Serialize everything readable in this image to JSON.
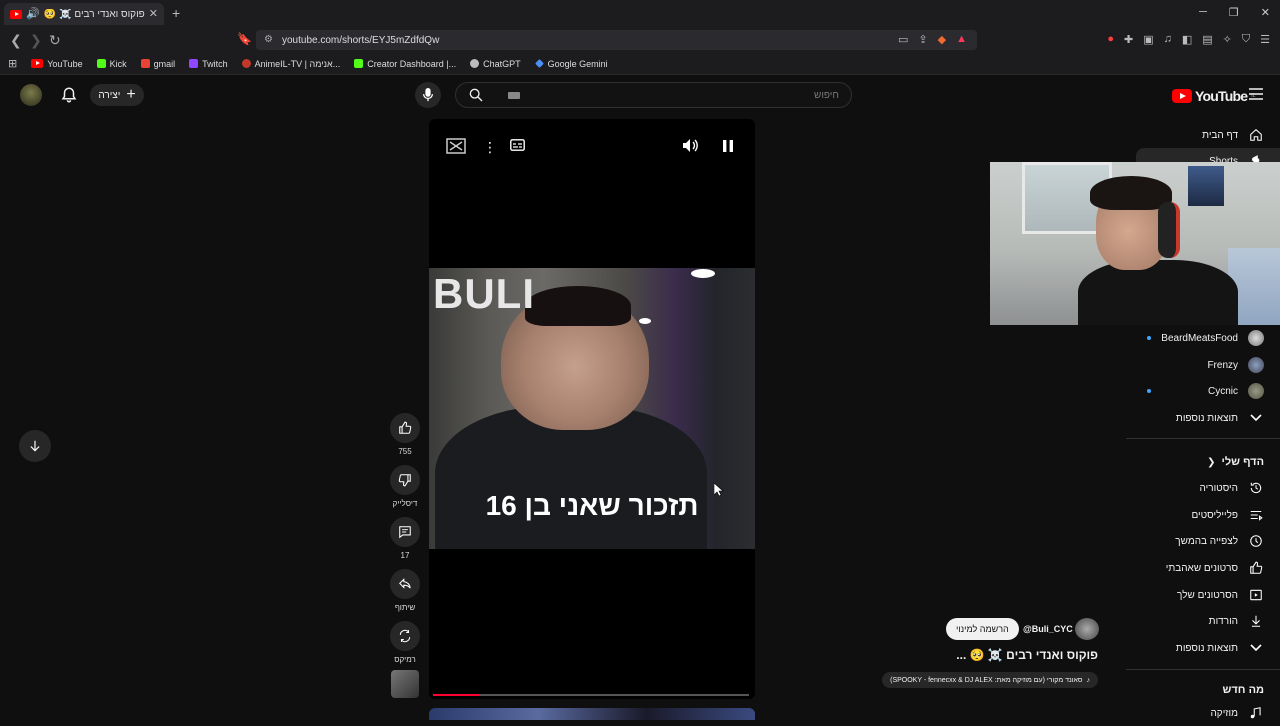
{
  "browser": {
    "tab_title": "פוקוס ואנדי רבים ☠️ 🥺 #fyp",
    "url": "youtube.com/shorts/EYJ5mZdfdQw",
    "bookmarks": [
      "YouTube",
      "Kick",
      "gmail",
      "Twitch",
      "AnimeIL-TV | אנימה...",
      "Creator Dashboard |...",
      "ChatGPT",
      "Google Gemini"
    ]
  },
  "header": {
    "create_label": "יצירה",
    "search_placeholder": "חיפוש",
    "logo_text": "YouTube",
    "logo_region": "IL"
  },
  "player": {
    "overlay_text": "BULI",
    "caption": "תזכור שאני בן 16",
    "progress": 0.15
  },
  "actions": {
    "like_count": "755",
    "dislike_label": "דיסלייק",
    "comment_count": "17",
    "share_label": "שיתוף",
    "remix_label": "רמיקס"
  },
  "video_info": {
    "channel": "@Buli_CYC",
    "subscribe_label": "הרשמה למינוי",
    "title": "פוקוס ואנדי רבים ☠️ 🥺 ...",
    "music": "סאונד מקורי (עם מוזיקה מאת: SPOOKY - fennecxx & DJ ALEX)"
  },
  "sidebar": {
    "home": "דף הבית",
    "shorts": "Shorts",
    "subscriptions": [
      {
        "name": "BeardMeatsFood",
        "new": true
      },
      {
        "name": "Frenzy",
        "new": false
      },
      {
        "name": "Cycnic",
        "new": true
      }
    ],
    "show_more": "תוצאות נוספות",
    "you_header": "הדף שלי",
    "you_items": [
      "היסטוריה",
      "פלייליסטים",
      "לצפייה בהמשך",
      "סרטונים שאהבתי",
      "הסרטונים שלך",
      "הורדות"
    ],
    "show_more_2": "תוצאות נוספות",
    "whats_new": "מה חדש",
    "music": "מוזיקה"
  },
  "colors": {
    "accent": "#ff0000",
    "background": "#0f0f0f",
    "progress": "#ff0033"
  }
}
